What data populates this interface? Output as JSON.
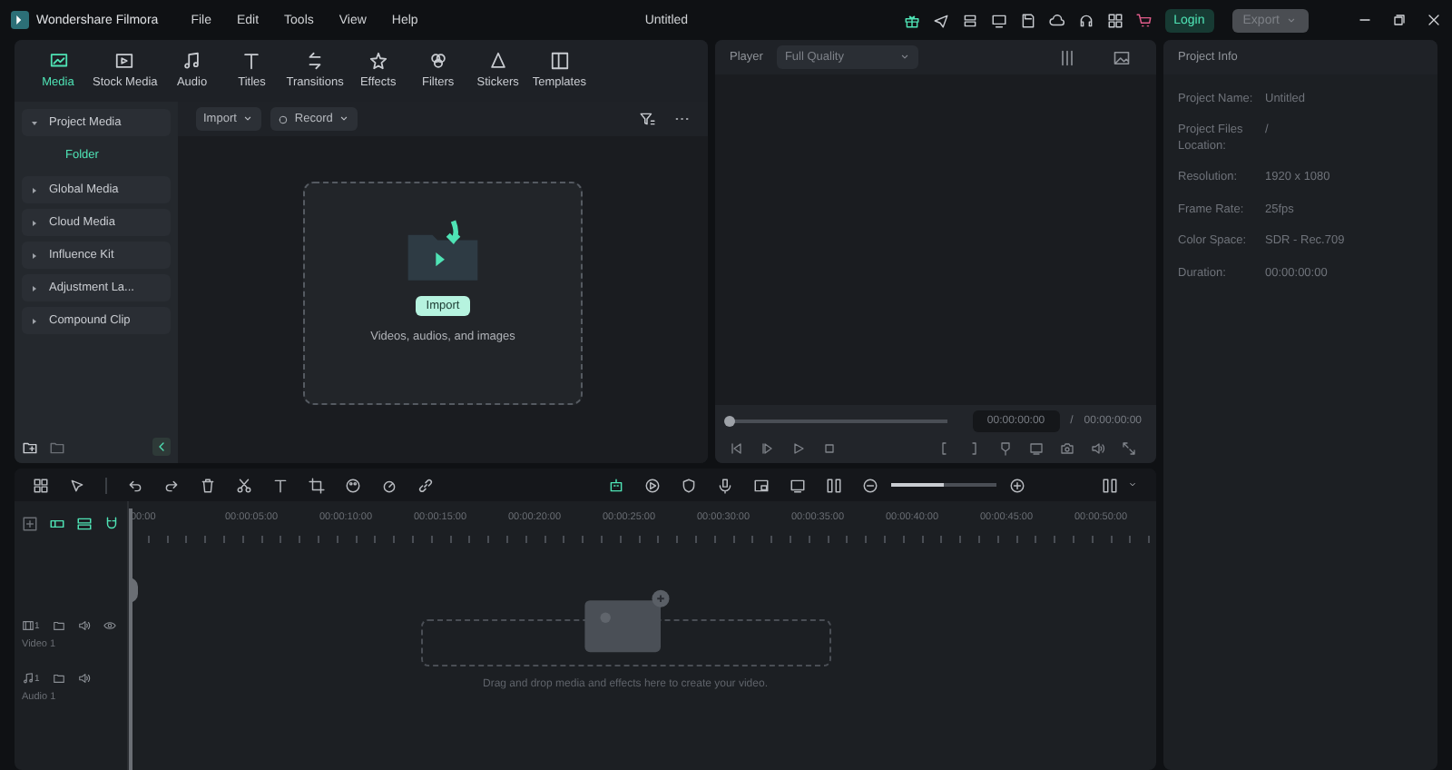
{
  "title_bar": {
    "app_name": "Wondershare Filmora",
    "menu": [
      "File",
      "Edit",
      "Tools",
      "View",
      "Help"
    ],
    "document_title": "Untitled",
    "login": "Login",
    "export": {
      "label": "Export",
      "disabled": true
    }
  },
  "media_panel": {
    "tabs": [
      {
        "label": "Media",
        "selected": true
      },
      {
        "label": "Stock Media",
        "selected": false
      },
      {
        "label": "Audio",
        "selected": false
      },
      {
        "label": "Titles",
        "selected": false
      },
      {
        "label": "Transitions",
        "selected": false
      },
      {
        "label": "Effects",
        "selected": false
      },
      {
        "label": "Filters",
        "selected": false
      },
      {
        "label": "Stickers",
        "selected": false
      },
      {
        "label": "Templates",
        "selected": false
      }
    ],
    "sidebar": [
      {
        "label": "Project Media",
        "expanded": true,
        "selected": false,
        "children": [
          {
            "label": "Folder",
            "selected": true
          }
        ]
      },
      {
        "label": "Global Media",
        "expanded": false,
        "selected": false
      },
      {
        "label": "Cloud Media",
        "expanded": false,
        "selected": false
      },
      {
        "label": "Influence Kit",
        "expanded": false,
        "selected": false
      },
      {
        "label": "Adjustment La...",
        "expanded": false,
        "selected": false
      },
      {
        "label": "Compound Clip",
        "expanded": false,
        "selected": false
      }
    ],
    "toolbar": [
      "Import",
      "Record"
    ],
    "drop_zone": {
      "button": "Import",
      "hint": "Videos, audios, and images"
    }
  },
  "player": {
    "label": "Player",
    "quality": "Full Quality",
    "scrubber": {
      "level": 0
    },
    "current_time": "00:00:00:00",
    "separator": "/",
    "total_time": "00:00:00:00"
  },
  "project_info": {
    "title": "Project Info",
    "rows": [
      {
        "label": "Project Name:",
        "value": "Untitled"
      },
      {
        "label": "Project Files Location:",
        "value": "/"
      },
      {
        "label": "Resolution:",
        "value": "1920 x 1080"
      },
      {
        "label": "Frame Rate:",
        "value": "25fps"
      },
      {
        "label": "Color Space:",
        "value": "SDR - Rec.709"
      },
      {
        "label": "Duration:",
        "value": "00:00:00:00"
      }
    ]
  },
  "timeline": {
    "zoom_slider": {
      "level": 0.5
    },
    "ruler": [
      "00:00",
      "00:00:05:00",
      "00:00:10:00",
      "00:00:15:00",
      "00:00:20:00",
      "00:00:25:00",
      "00:00:30:00",
      "00:00:35:00",
      "00:00:40:00",
      "00:00:45:00",
      "00:00:50:00"
    ],
    "tracks": [
      {
        "kind": "video",
        "number": "1",
        "label": "Video 1"
      },
      {
        "kind": "audio",
        "number": "1",
        "label": "Audio 1"
      }
    ],
    "drop_hint": "Drag and drop media and effects here to create your video."
  }
}
